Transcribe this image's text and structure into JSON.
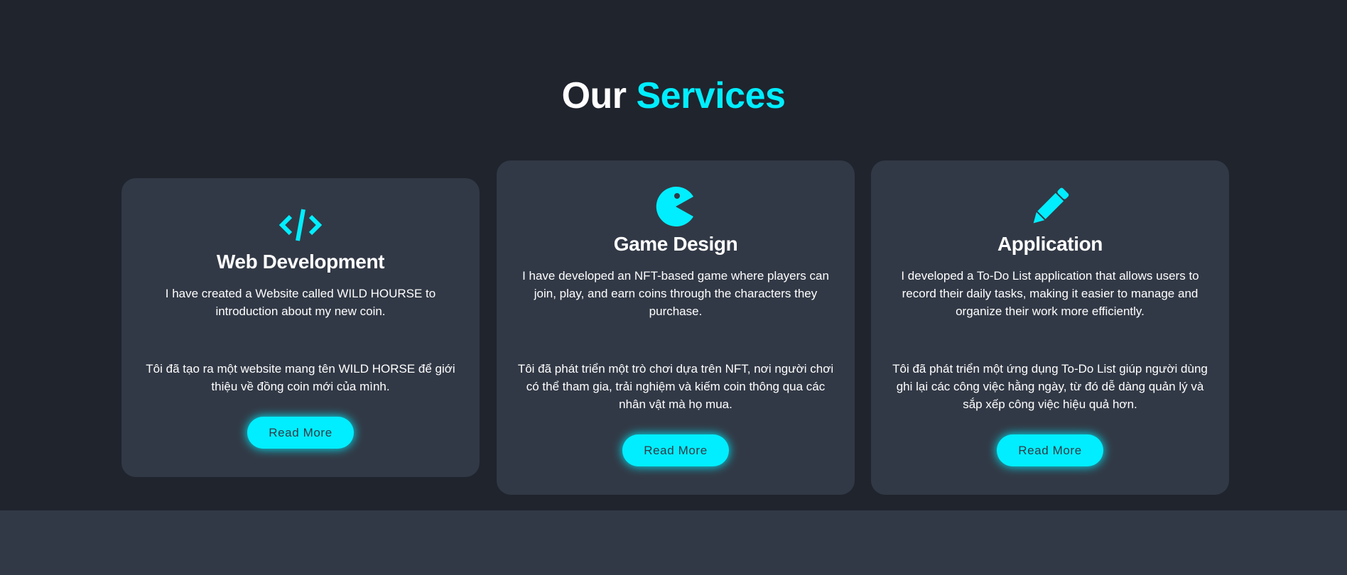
{
  "section": {
    "title_part1": "Our",
    "title_part2": "Services"
  },
  "colors": {
    "background": "#1f242d",
    "card": "#323946",
    "accent": "#00eeff"
  },
  "cards": [
    {
      "icon": "code-icon",
      "title": "Web Development",
      "desc_en": "I have created a Website called WILD HOURSE to introduction about my new coin.",
      "desc_vi": "Tôi đã tạo ra một website mang tên WILD HORSE để giới thiệu về đồng coin mới của mình.",
      "button": "Read More"
    },
    {
      "icon": "pacman-icon",
      "title": "Game Design",
      "desc_en": "I have developed an NFT-based game where players can join, play, and earn coins through the characters they purchase.",
      "desc_vi": "Tôi đã phát triển một trò chơi dựa trên NFT, nơi người chơi có thể tham gia, trải nghiệm và kiếm coin thông qua các nhân vật mà họ mua.",
      "button": "Read More"
    },
    {
      "icon": "pencil-icon",
      "title": "Application",
      "desc_en": "I developed a To-Do List application that allows users to record their daily tasks, making it easier to manage and organize their work more efficiently.",
      "desc_vi": "Tôi đã phát triển một ứng dụng To-Do List giúp người dùng ghi lại các công việc hằng ngày, từ đó dễ dàng quản lý và sắp xếp công việc hiệu quả hơn.",
      "button": "Read More"
    }
  ]
}
